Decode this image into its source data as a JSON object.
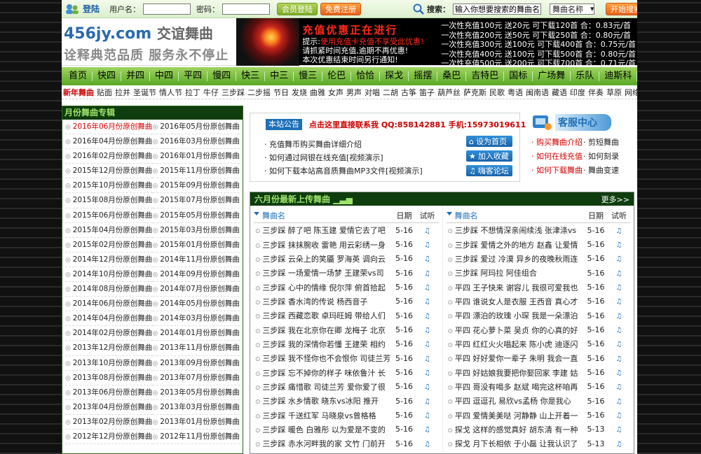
{
  "topbar": {
    "login_label": "登陆",
    "username_label": "用户名：",
    "password_label": "密码：",
    "member_login": "会员登陆",
    "free_register": "免费注册",
    "search_label": "搜索：",
    "search_value": "输入你想要搜索的舞曲名",
    "search_type": "舞曲名称",
    "search_button": "开始搜索"
  },
  "header": {
    "logo_domain": "456jy.com",
    "logo_cn": "交谊舞曲",
    "slogan": "诠释典范品质 服务永不停止"
  },
  "promo": {
    "title": "充值优惠正在进行",
    "tip_prefix": "提示:",
    "tip_red": "使用充值卡充值不享受此优惠!",
    "line2": "请抓紧时间充值,逾期不再优惠!",
    "line3": "本次优惠结束时间另行通知!",
    "rates": [
      "一次性充值100元 送20元   可下载120首   合：0.83元/首",
      "一次性充值200元 送50元   可下载250首   合：0.80元/首",
      "一次性充值300元 送100元  可下载400首   合：0.75元/首",
      "一次性充值400元 送100元  可下载500首   合：0.80元/首",
      "一次性充值500元 送200元  可下载700首   合：0.71元/首"
    ]
  },
  "nav": [
    "首页",
    "快四",
    "并四",
    "中四",
    "平四",
    "慢四",
    "快三",
    "中三",
    "慢三",
    "伦巴",
    "恰恰",
    "探戈",
    "摇摆",
    "桑巴",
    "吉特巴",
    "国标",
    "广场舞",
    "乐队",
    "迪斯科",
    "推荐",
    "排行"
  ],
  "subnav": [
    "新年舞曲",
    "贴面",
    "拉并",
    "圣诞节",
    "情人节",
    "拉丁",
    "牛仔",
    "三步踩",
    "二步摇",
    "节日",
    "发烧",
    "曲雅",
    "女声",
    "男声",
    "对唱",
    "二胡",
    "古筝",
    "笛子",
    "葫芦丝",
    "萨克斯",
    "民歌",
    "粤语",
    "闽南语",
    "藏语",
    "印度",
    "伴奏",
    "草原",
    "网络"
  ],
  "left": {
    "title": "月份舞曲专辑",
    "items": [
      "2016年06月份原创舞曲",
      "2016年05月份原创舞曲",
      "2016年04月份原创舞曲",
      "2016年03月份原创舞曲",
      "2016年02月份原创舞曲",
      "2016年01月份原创舞曲",
      "2015年12月份原创舞曲",
      "2015年11月份原创舞曲",
      "2015年10月份原创舞曲",
      "2015年09月份原创舞曲",
      "2015年08月份原创舞曲",
      "2015年07月份原创舞曲",
      "2015年06月份原创舞曲",
      "2015年05月份原创舞曲",
      "2015年04月份原创舞曲",
      "2015年03月份原创舞曲",
      "2015年02月份原创舞曲",
      "2015年01月份原创舞曲",
      "2014年12月份原创舞曲",
      "2014年11月份原创舞曲",
      "2014年10月份原创舞曲",
      "2014年09月份原创舞曲",
      "2014年08月份原创舞曲",
      "2014年07月份原创舞曲",
      "2014年06月份原创舞曲",
      "2014年05月份原创舞曲",
      "2014年04月份原创舞曲",
      "2014年03月份原创舞曲",
      "2014年02月份原创舞曲",
      "2014年01月份原创舞曲",
      "2013年12月份原创舞曲",
      "2013年11月份原创舞曲",
      "2013年10月份原创舞曲",
      "2013年09月份原创舞曲",
      "2013年08月份原创舞曲",
      "2013年07月份原创舞曲",
      "2013年06月份原创舞曲",
      "2013年05月份原创舞曲",
      "2013年04月份原创舞曲",
      "2013年03月份原创舞曲",
      "2013年02月份原创舞曲",
      "2013年01月份原创舞曲",
      "2012年12月份原创舞曲",
      "2012年11月份原创舞曲"
    ]
  },
  "notice": {
    "tab": "本站公告",
    "headline": "点击这里直接联系我  QQ:858142881  手机:15973019611",
    "items": [
      "充值舞币购买舞曲详细介绍",
      "如何通过网银在线充值[视频演示]",
      "如何下载本站高音质舞曲MP3文件[视频演示]"
    ],
    "btn_home": "设为首页",
    "btn_fav": "加入收藏",
    "btn_forum": "嗨客论坛"
  },
  "kefu": {
    "title": "客服中心",
    "links": [
      [
        "购买舞曲介绍",
        "剪短舞曲"
      ],
      [
        "如何在线充值",
        "如何刻录"
      ],
      [
        "如何下载舞曲",
        "舞曲变速"
      ]
    ]
  },
  "songs": {
    "title": "六月份最新上传舞曲",
    "more": "更多>>",
    "col_name": "舞曲名",
    "col_date": "日期",
    "col_play": "试听",
    "left": [
      [
        "三步踩  醉了吧 陈玉建  爱情它去了吧",
        "5-16"
      ],
      [
        "三步踩  抹抹腕收 雷艳  用云彩绣一身",
        "5-16"
      ],
      [
        "三步踩  云朵上的笑靥 罗海英  调向云",
        "5-16"
      ],
      [
        "三步踩  一场爱情一场梦  王建荣vs司",
        "5-16"
      ],
      [
        "三步踩  心中的情缘 倪尔萍  俯首拾起",
        "5-16"
      ],
      [
        "三步踩  香水湾的传说 杨西音子",
        "5-16"
      ],
      [
        "三步踩  西藏恋歌 卓玛旺姆  带给人们",
        "5-16"
      ],
      [
        "三步踩  我在北京你在卿  龙梅子  北京",
        "5-16"
      ],
      [
        "三步踩  我的深情你若懂  王建荣  相约",
        "5-16"
      ],
      [
        "三步踩  我不怪你也不会恨你  司徒兰芳",
        "5-16"
      ],
      [
        "三步踩  忘不掉你的样子  咪依鲁汁  长",
        "5-16"
      ],
      [
        "三步踩  痛惜歌 司徒兰芳  爱你爱了很",
        "5-16"
      ],
      [
        "三步踩  水乡情歌 晓东vs冰阳  推开",
        "5-16"
      ],
      [
        "三步踩  千送红军 马晓泉vs曾格格",
        "5-16"
      ],
      [
        "三步踩  暖色  白雅彤  以为爱是不变的",
        "5-16"
      ],
      [
        "三步踩  赤水河畔我的家  文竹  门前开",
        "5-16"
      ]
    ],
    "right": [
      [
        "三步踩  不想情深亲闹续浅  张津涤vs",
        "5-16"
      ],
      [
        "三步踩  爱情之外的地方  赵鑫  让爱情",
        "5-16"
      ],
      [
        "三步踩  爱过  冷漠  异乡的夜晚秋雨连",
        "5-16"
      ],
      [
        "三步踩  阿玛拉  阿佳组合",
        "5-16"
      ],
      [
        "平四  王子快来  谢容儿  我很可爱我也",
        "5-16"
      ],
      [
        "平四  谁说女人是衣服  王西音  真心才",
        "5-16"
      ],
      [
        "平四  漂泊的玫瑰  小琛  我是一朵漂泊",
        "5-16"
      ],
      [
        "平四  花心萝卜菜  吴贞  你的心真的好",
        "5-16"
      ],
      [
        "平四  红红火火唱起来  陈小虎  迪逐闪",
        "5-16"
      ],
      [
        "平四  好好爱你一辈子  朱明  我会一直",
        "5-16"
      ],
      [
        "平四  好姑娘我要把你娶回家  李建  姑",
        "5-16"
      ],
      [
        "平四  哥没有喝多  赵斌  喝完这杯咱再",
        "5-16"
      ],
      [
        "平四  逗逗孔  易欣vs孟杨  你是我心",
        "5-16"
      ],
      [
        "平四  爱情美美哒  河静静  山上开着一",
        "5-16"
      ],
      [
        "探戈  这样的感觉真好  胡东清  有一种",
        "5-13"
      ],
      [
        "探戈  月下长相依  于小磊  让我认识了",
        "5-13"
      ]
    ]
  }
}
